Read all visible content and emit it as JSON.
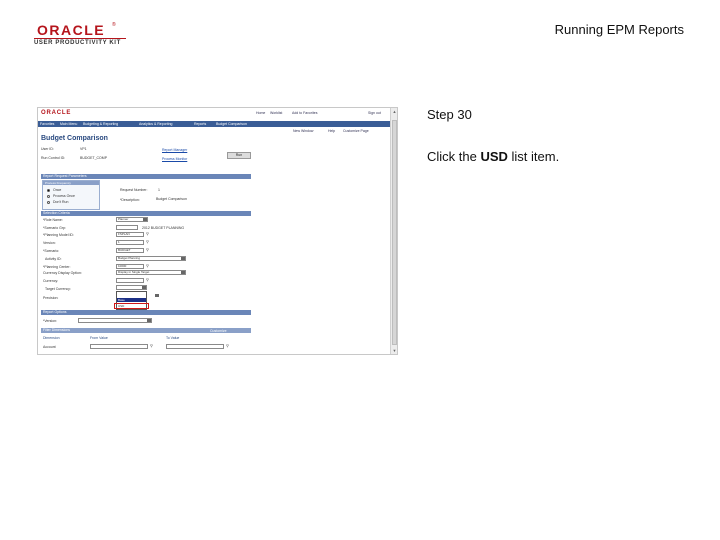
{
  "header": {
    "logo_oracle": "ORACLE",
    "logo_subtitle": "USER PRODUCTIVITY KIT",
    "doc_title": "Running EPM Reports"
  },
  "step": {
    "title": "Step 30",
    "instruction_prefix": "Click the ",
    "instruction_target": "USD",
    "instruction_suffix": " list item."
  },
  "app": {
    "logo": "ORACLE",
    "top_links": [
      "Home",
      "Worklist",
      "Add to Favorites",
      "Sign out"
    ],
    "menu": [
      "Favorites",
      "Main Menu",
      "Budgeting & Reporting",
      "Analytics & Reporting",
      "Reports",
      "Budget Comparison"
    ],
    "right_links": [
      "New Window",
      "Help",
      "Customize Page"
    ],
    "page_title": "Budget Comparison",
    "user_id_label": "User ID:",
    "user_id_value": "VP1",
    "run_control_label": "Run Control ID:",
    "run_control_value": "BUDGET_COMP",
    "report_manager_link": "Report Manager",
    "process_monitor_link": "Process Monitor",
    "run_button": "Run",
    "section_report_request": "Report Request Parameters",
    "subsection_process_frequency": "Process Frequency",
    "radio_once": "Once",
    "radio_always": "Process Once",
    "radio_dont_run": "Don't Run",
    "request_number_label": "Request Number:",
    "request_number_value": "1",
    "description_label": "*Description:",
    "description_value": "Budget Comparison",
    "section_selection": "Selection Criteria",
    "role_label": "*Role Name:",
    "role_value": "Planner",
    "scenario_label": "*Scenario Grp:",
    "scenario_value": "2012 BUDGET PLANNING",
    "planning_model_label": "*Planning Model ID:",
    "planning_model_value": "FSPLAN",
    "version_label": "Version:",
    "version_value": "1",
    "scenario_name_label": "*Scenario:",
    "scenario_name_value": "BUDGET",
    "activity_label": "Activity ID:",
    "activity_value": "Budget Planning",
    "planning_center_label": "*Planning Center:",
    "planning_center_value": "10000",
    "currency_option_label": "Currency Display Option:",
    "currency_option_value": "Display in Single Target",
    "currency_label": "Currency:",
    "target_currency_label": "Target Currency:",
    "precision_label": "Precision:",
    "dropdown_options": [
      "",
      "Base",
      "USD"
    ],
    "section_report": "Report Options",
    "report_layout_label": "*Version:",
    "subsection_filter": "Filter Dimensions",
    "customize_link": "Customize",
    "col_dimension": "Dimension",
    "col_from": "From Value",
    "col_to": "To Value",
    "row_account": "Account"
  },
  "colors": {
    "oracle_red": "#b5141b",
    "menu_bar": "#3a5d96",
    "highlight": "#1b2f86",
    "target_box": "#d01818"
  }
}
